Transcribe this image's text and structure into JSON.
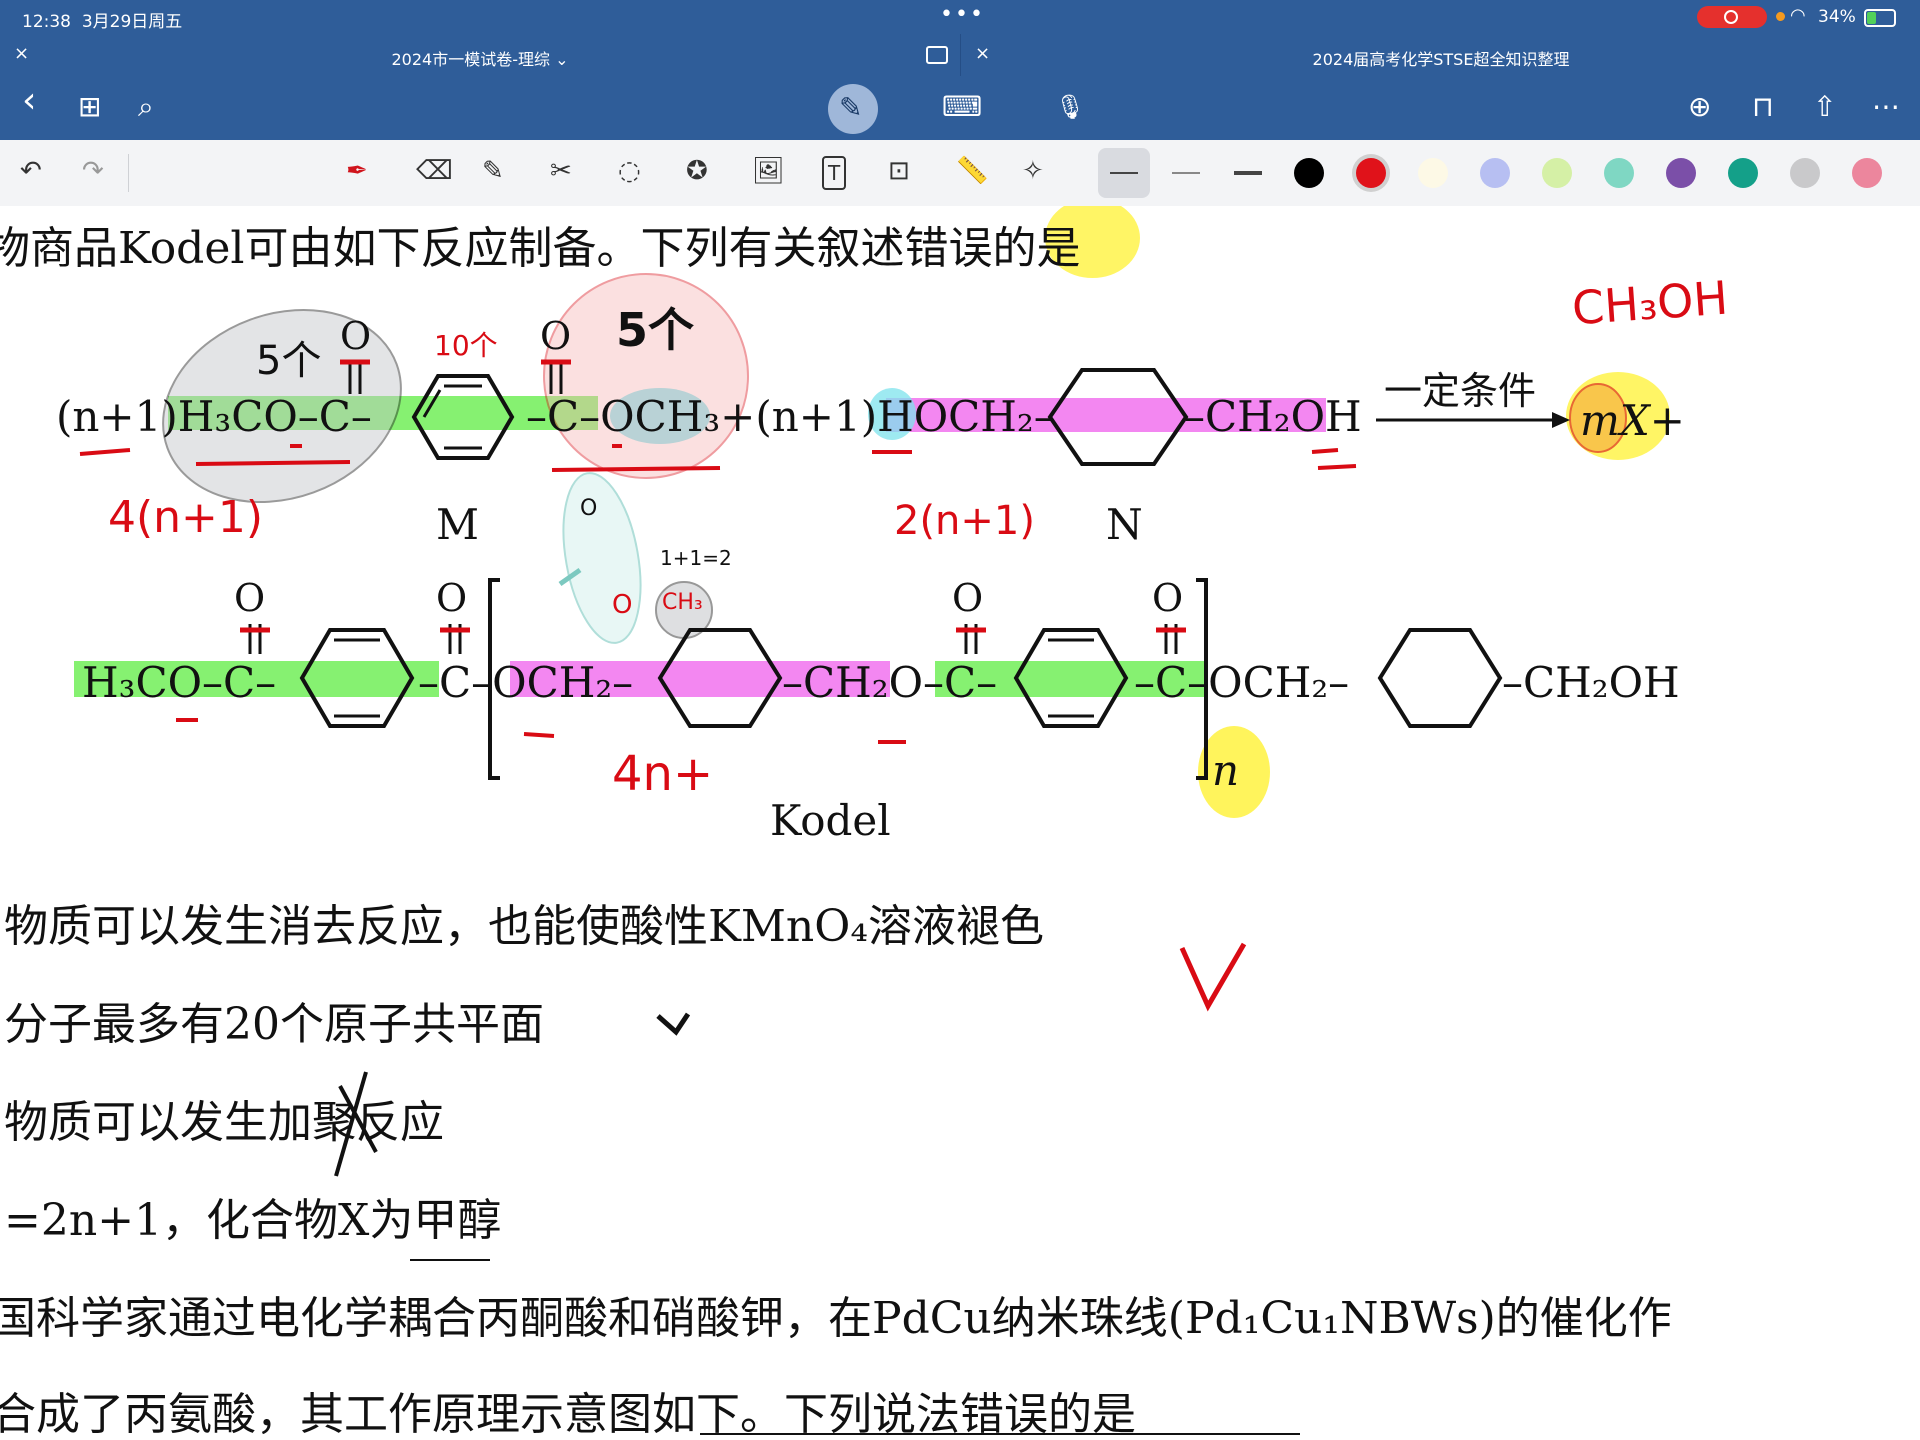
{
  "status_bar": {
    "time": "12:38",
    "date": "3月29日周五",
    "more": "•••",
    "battery": "34%"
  },
  "tabs": [
    {
      "title": "2024市一模试卷-理综 ⌄",
      "close": "×"
    },
    {
      "title": "2024届高考化学STSE超全知识整理",
      "close": "×"
    }
  ],
  "toolbar": {
    "back": "‹",
    "grid": "⊞",
    "search": "⌕",
    "pen": "✎",
    "keyboard": "⌨",
    "mic": "🎙",
    "add_page": "⊕",
    "bookmark": "⊓",
    "share": "⇧",
    "more": "⋯"
  },
  "annotation_bar": {
    "undo": "↶",
    "redo": "↷",
    "tools": [
      "✒",
      "⌫",
      "✎",
      "✂",
      "◌",
      "✪",
      "🖼",
      "T",
      "⊡",
      "📏",
      "✧"
    ],
    "colors": [
      "#000000",
      "#e0121a",
      "#fdf9e6",
      "#b7bff2",
      "#d5f0a6",
      "#7fd7c3",
      "#7b4fa8",
      "#14a089",
      "#c9c9cb",
      "#ec869d"
    ],
    "selected_color": "#e0121a"
  },
  "document": {
    "title": "物商品Kodel可由如下反应制备。下列有关叙述错误的是",
    "reaction_left": "(n+1)H₃CO–C–",
    "reaction_mid": "–C–OCH₃+(n+1)HOCH₂–",
    "reaction_right": "–CH₂OH",
    "arrow_label": "一定条件",
    "product": "mX+",
    "label_m": "M",
    "label_n": "N",
    "polymer_left": "H₃CO–C–",
    "polymer_mid": "–C–OCH₂–",
    "polymer_mid2": "–CH₂O–C–",
    "polymer_mid3": "–C–OCH₂–",
    "polymer_right": "–CH₂OH",
    "polymer_n": "n",
    "polymer_name": "Kodel",
    "oxygen": "O",
    "options": [
      "物质可以发生消去反应，也能使酸性KMnO₄溶液褪色",
      "分子最多有20个原子共平面",
      "物质可以发生加聚反应",
      "=2n+1，化合物X为甲醇"
    ],
    "next_question_1": "国科学家通过电化学耦合丙酮酸和硝酸钾，在PdCu纳米珠线(Pd₁Cu₁NBWs)的催化作",
    "next_question_2": "合成了丙氨酸，其工作原理示意图如下。下列说法错误的是"
  },
  "handwriting": {
    "ch3oh": "CH₃OH",
    "five_a": "5个",
    "ten": "10个",
    "five_b": "5个",
    "four_n1": "4(n+1)",
    "two_n1": "2(n+1)",
    "four_n": "4n+",
    "one_one": "1+1=2",
    "ch3": "CH₃",
    "check1": "✓",
    "check2": "✓"
  }
}
